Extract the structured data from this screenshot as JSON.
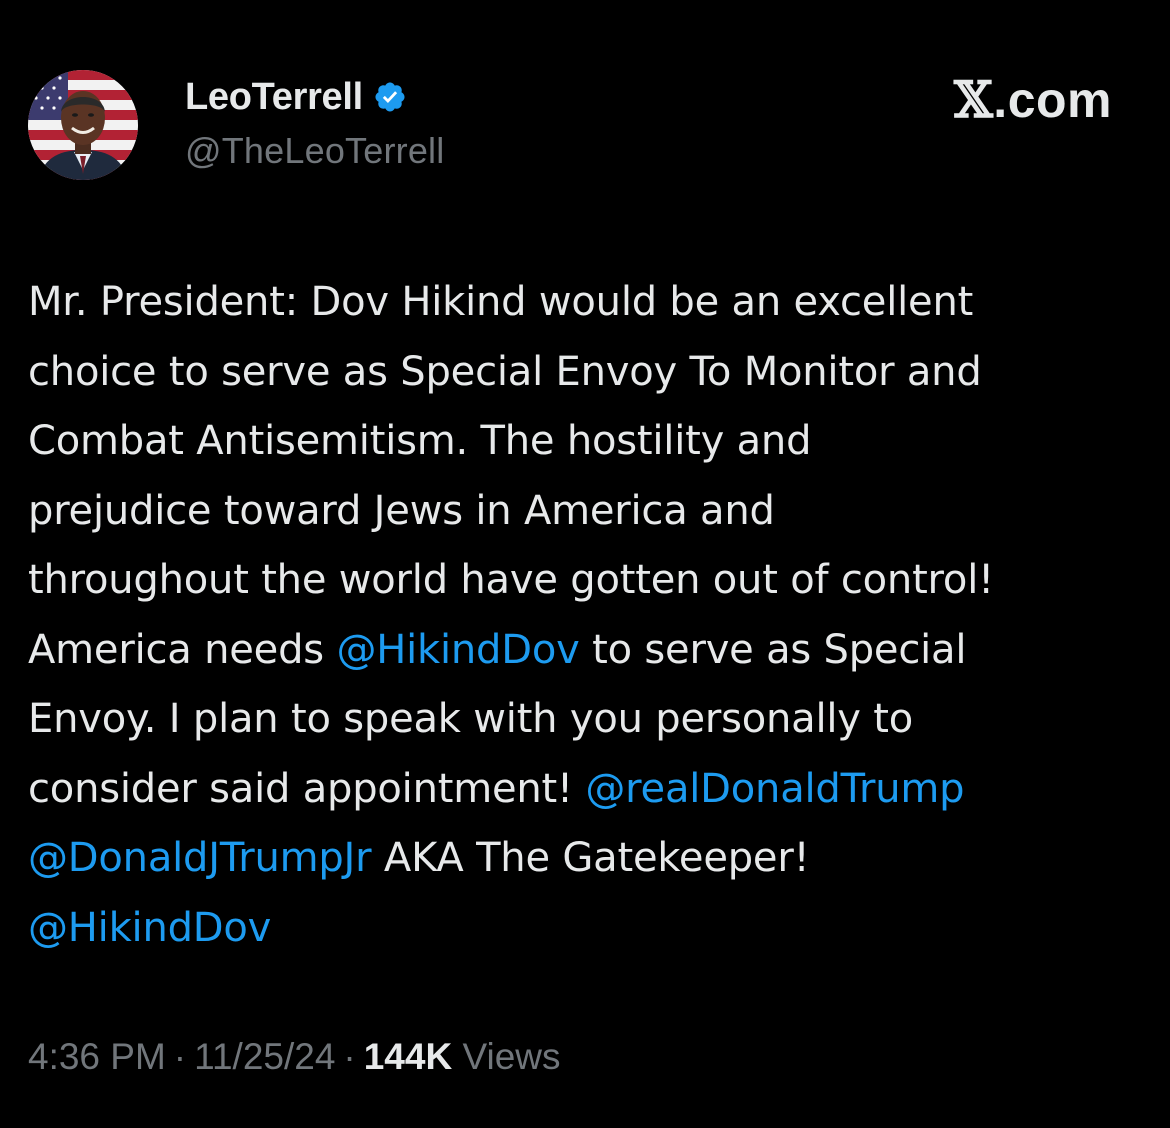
{
  "author": {
    "display_name": "LeoTerrell",
    "handle": "@TheLeoTerrell",
    "verified_icon": "verified-badge-icon",
    "verified_color": "#1d9bf0"
  },
  "watermark": {
    "x_glyph": "𝕏",
    "suffix": ".com"
  },
  "tweet": {
    "lines": [
      [
        {
          "text": "Mr. President:  Dov Hikind would be an excellent",
          "mention": false
        }
      ],
      [
        {
          "text": "choice to serve as Special Envoy To Monitor and",
          "mention": false
        }
      ],
      [
        {
          "text": "Combat Antisemitism. The hostility and",
          "mention": false
        }
      ],
      [
        {
          "text": "prejudice toward Jews in America and",
          "mention": false
        }
      ],
      [
        {
          "text": "throughout the world have gotten out of control!",
          "mention": false
        }
      ],
      [
        {
          "text": "America needs ",
          "mention": false
        },
        {
          "text": "@HikindDov",
          "mention": true
        },
        {
          "text": " to serve as Special",
          "mention": false
        }
      ],
      [
        {
          "text": "Envoy. I plan to speak with you personally to",
          "mention": false
        }
      ],
      [
        {
          "text": "consider said appointment! ",
          "mention": false
        },
        {
          "text": "@realDonaldTrump",
          "mention": true
        }
      ],
      [
        {
          "text": "@DonaldJTrumpJr",
          "mention": true
        },
        {
          "text": " AKA The Gatekeeper!",
          "mention": false
        }
      ],
      [
        {
          "text": "@HikindDov",
          "mention": true
        }
      ]
    ]
  },
  "meta": {
    "time": "4:36 PM",
    "separator": "·",
    "date": "11/25/24",
    "views_count": "144K",
    "views_label": "Views"
  },
  "colors": {
    "background": "#000000",
    "text_primary": "#e7e9ea",
    "text_secondary": "#71767b",
    "link": "#1d9bf0"
  }
}
